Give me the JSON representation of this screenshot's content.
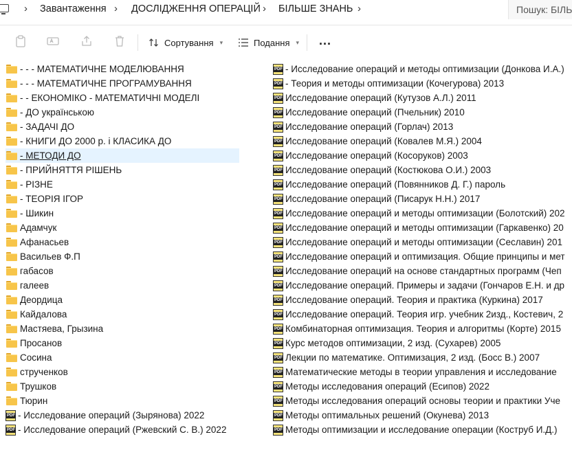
{
  "breadcrumb": {
    "items": [
      "Завантаження",
      "ДОСЛІДЖЕННЯ ОПЕРАЦІЙ",
      "БІЛЬШЕ ЗНАНЬ"
    ],
    "separator": "›"
  },
  "search": {
    "placeholder": "Пошук: БІЛЬ"
  },
  "toolbar": {
    "sort_label": "Сортування",
    "view_label": "Подання",
    "more_label": "..."
  },
  "folders": [
    "- - -  МАТЕМАТИЧНЕ МОДЕЛЮВАННЯ",
    "- - -  МАТЕМАТИЧНЕ ПРОГРАМУВАННЯ",
    "- - ЕКОНОМІКО - МАТЕМАТИЧНІ МОДЕЛІ",
    "- ДО українською",
    "- ЗАДАЧІ ДО",
    "- КНИГИ ДО 2000 р. і  КЛАСИКА ДО",
    "- МЕТОДИ ДО",
    "- ПРИЙНЯТТЯ РІШЕНЬ",
    "- РІЗНЕ",
    "- ТЕОРІЯ ІГОР",
    "- Шикин",
    "Адамчук",
    "Афанасьев",
    "Васильев Ф.П",
    "габасов",
    "галеев",
    "Деордица",
    "Кайдалова",
    "Мастяева, Грызина",
    "Просанов",
    "Сосина",
    "струченков",
    "Трушков",
    "Тюрин"
  ],
  "selected_folder_index": 6,
  "files_col1": [
    "- Исследование операций (Зырянова) 2022",
    "- Исследование операций (Ржевский С. В.) 2022"
  ],
  "files_col2": [
    "- Исследование операций и методы оптимизации (Донкова И.А.)",
    "- Теория и методы оптимизации (Кочегурова) 2013",
    "Исследование операций  (Кутузов А.Л.) 2011",
    "Исследование операций  (Пчельник) 2010",
    "Исследование операций (Горлач) 2013",
    "Исследование операций (Ковалев М.Я.) 2004",
    "Исследование операций (Косоруков) 2003",
    "Исследование операций (Костюкова О.И.) 2003",
    "Исследование операций (Повянников Д. Г.)  пароль",
    "Исследование операций (Писарук Н.Н.) 2017",
    "Исследование операций и методы оптимизации (Болотский) 202",
    "Исследование операций и методы оптимизации (Гаркавенко) 20",
    "Исследование операций и методы оптимизации (Сеславин) 201",
    "Исследование операций и оптимизация. Общие принципы и мет",
    "Исследование операций на основе стандартных программ (Чеп",
    "Исследование операций. Примеры и задачи (Гончаров Е.Н. и др",
    "Исследование операций. Теория и практика (Куркина) 2017",
    "Исследование операций. Теория игр. учебник 2изд., Костевич, 2",
    "Комбинаторная оптимизация. Теория и алгоритмы (Корте) 2015",
    "Курс методов оптимизации, 2 изд. (Сухарев) 2005",
    "Лекции по математике. Оптимизация, 2 изд. (Босс В.) 2007",
    "Математические методы в теории управления и исследование",
    "Методы исследования операций (Есипов) 2022",
    "Методы исследования операций основы теории и практики Уче",
    "Методы оптимальных решений (Окунева) 2013",
    "Методы оптимизации и исследование операции (Коструб И.Д.)"
  ]
}
